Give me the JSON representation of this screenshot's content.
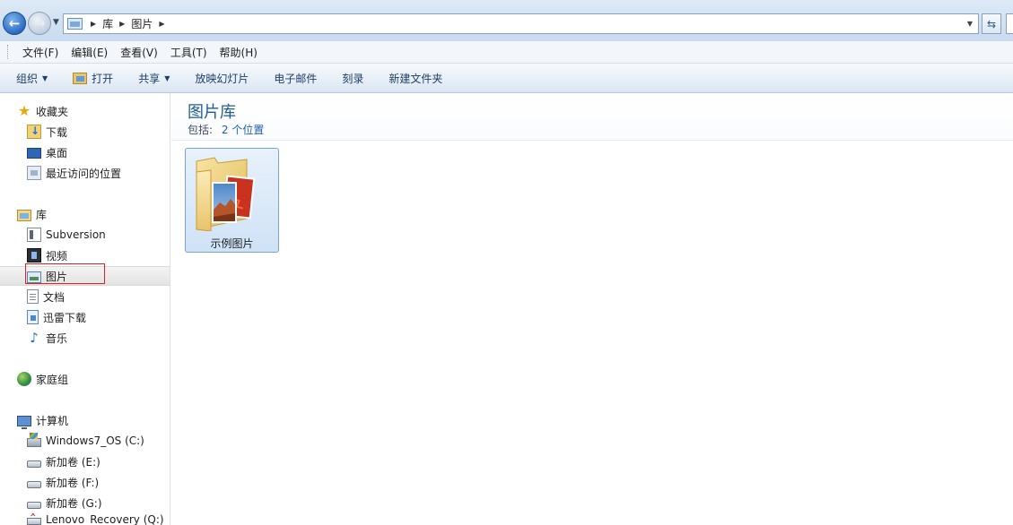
{
  "address": {
    "breadcrumbs": [
      "库",
      "图片"
    ]
  },
  "menu": {
    "items": [
      "文件(F)",
      "编辑(E)",
      "查看(V)",
      "工具(T)",
      "帮助(H)"
    ]
  },
  "toolbar": {
    "organize": "组织",
    "open": "打开",
    "share": "共享",
    "slideshow": "放映幻灯片",
    "email": "电子邮件",
    "burn": "刻录",
    "new_folder": "新建文件夹"
  },
  "nav": {
    "favorites": "收藏夹",
    "downloads": "下载",
    "desktop": "桌面",
    "recent": "最近访问的位置",
    "libraries": "库",
    "subversion": "Subversion",
    "videos": "视频",
    "pictures": "图片",
    "documents": "文档",
    "thunder": "迅雷下载",
    "music": "音乐",
    "homegroup": "家庭组",
    "computer": "计算机",
    "drive_c": "Windows7_OS (C:)",
    "drive_e": "新加卷 (E:)",
    "drive_f": "新加卷 (F:)",
    "drive_g": "新加卷 (G:)",
    "drive_q": "Lenovo_Recovery (Q:)"
  },
  "content": {
    "library_title": "图片库",
    "includes_label": "包括:",
    "includes_link": "2 个位置",
    "folders": [
      {
        "name": "示例图片"
      }
    ]
  },
  "icons": {
    "back": "back-arrow-icon",
    "forward": "forward-arrow-icon",
    "refresh": "refresh-icon",
    "favorites": "star-icon",
    "music": "music-note-icon"
  },
  "colors": {
    "title_text": "#1e5e8e",
    "link": "#1a5fb4",
    "selection_border": "#7da2ce",
    "annotation": "#e02020"
  }
}
